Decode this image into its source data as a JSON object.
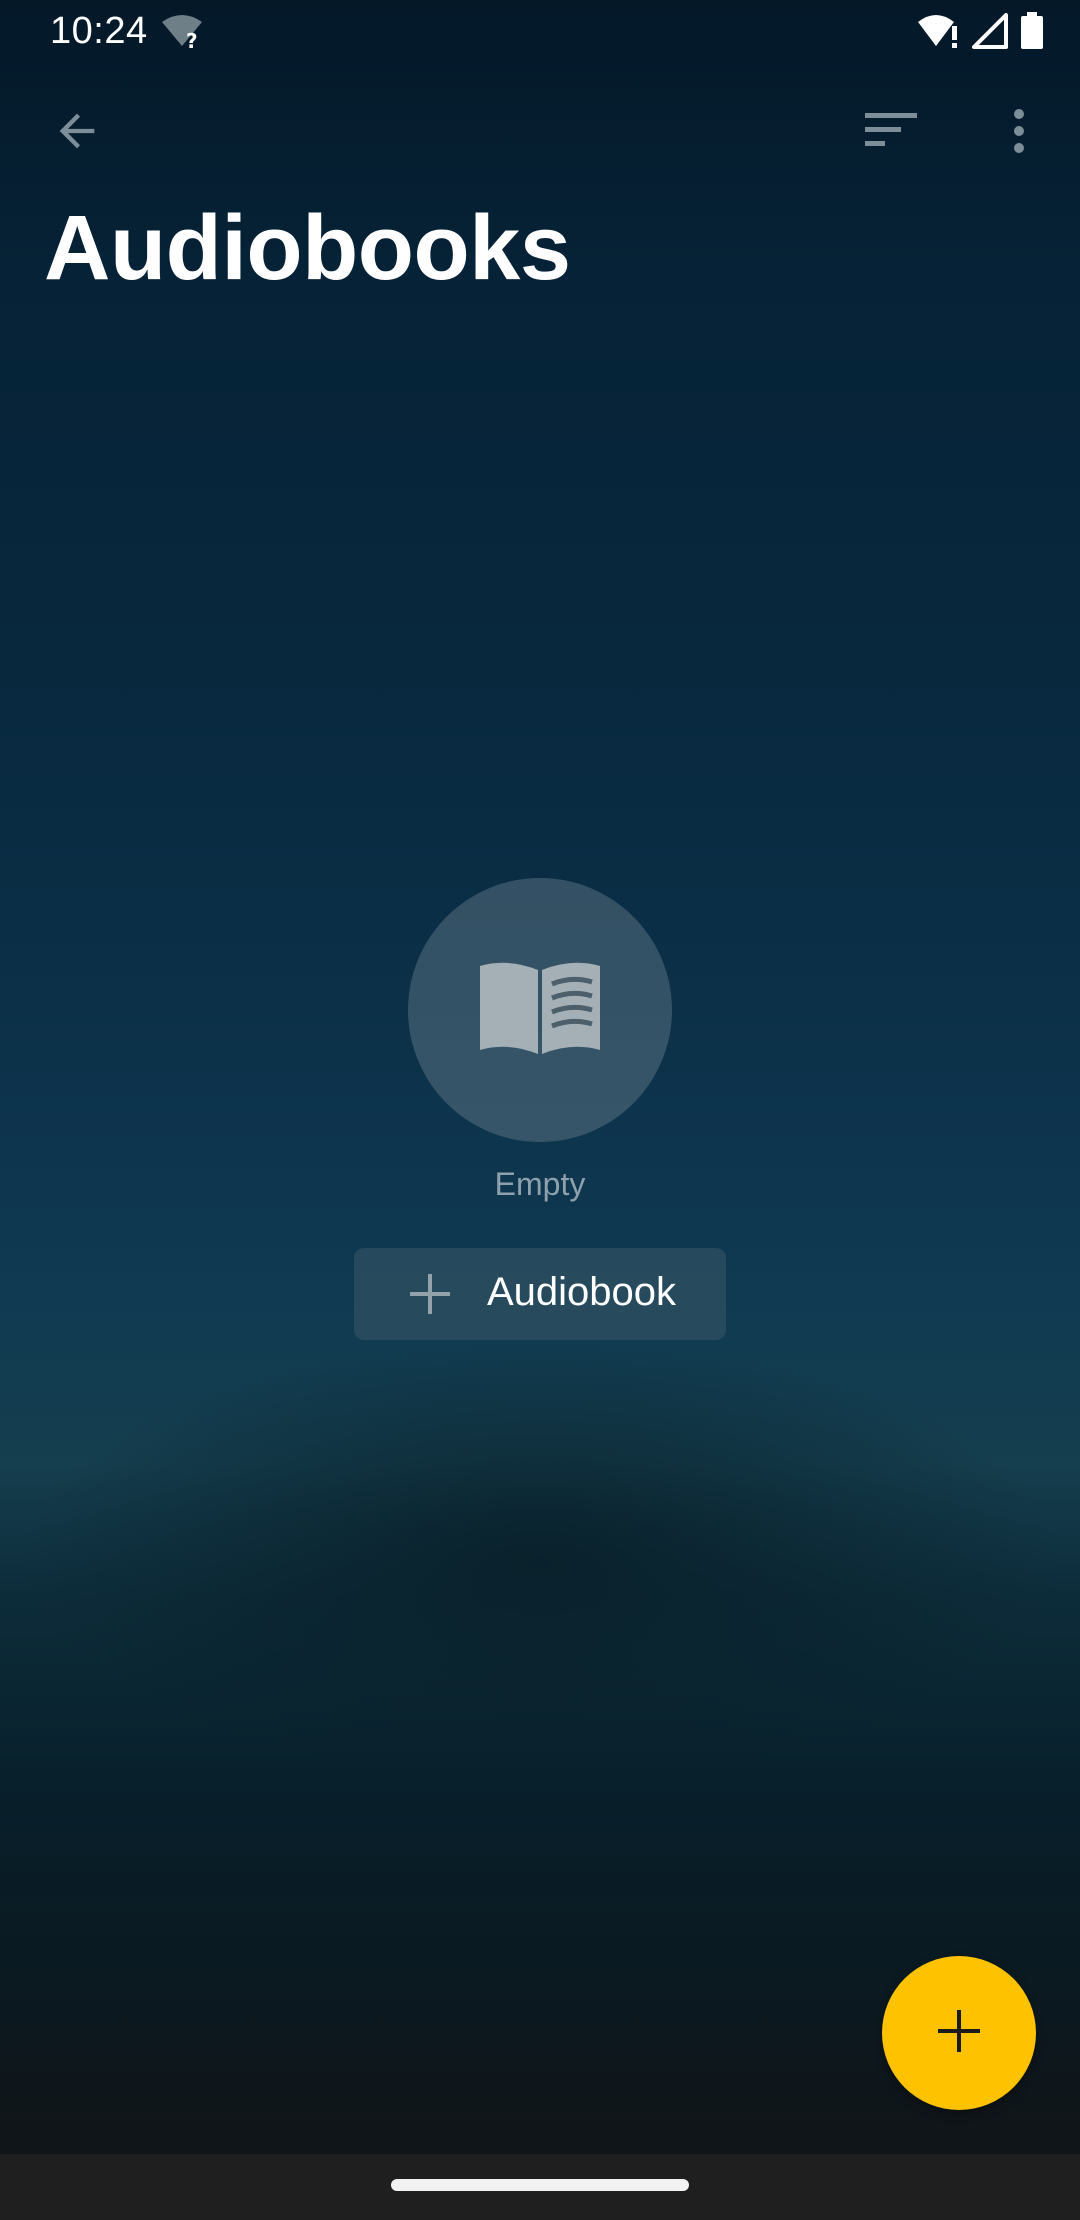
{
  "status_bar": {
    "time": "10:24",
    "icons": [
      "wifi-unknown-icon",
      "wifi-alert-icon",
      "cell-signal-icon",
      "battery-icon"
    ]
  },
  "app_bar": {
    "back_icon": "arrow-back-icon",
    "sort_icon": "sort-icon",
    "more_icon": "more-vert-icon"
  },
  "page": {
    "title": "Audiobooks"
  },
  "empty_state": {
    "icon": "open-book-icon",
    "label": "Empty",
    "add_button_label": "Audiobook",
    "add_button_icon": "plus-icon"
  },
  "fab": {
    "icon": "plus-icon",
    "color": "#fec200"
  }
}
